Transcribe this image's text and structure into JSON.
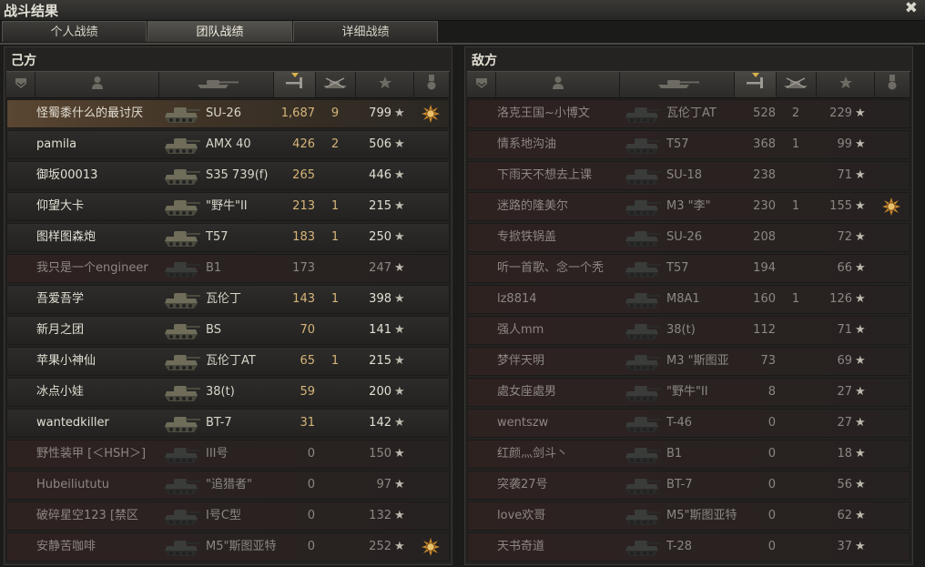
{
  "window": {
    "title": "战斗结果"
  },
  "tabs": [
    {
      "label": "个人战绩",
      "active": false
    },
    {
      "label": "团队战绩",
      "active": true
    },
    {
      "label": "详细战绩",
      "active": false
    }
  ],
  "left": {
    "title": "己方",
    "rows": [
      {
        "name": "怪蜀黍什么的最讨厌",
        "vehicle": "SU-26",
        "damage": "1,687",
        "kills": "9",
        "xp": "799",
        "mine": true,
        "alive": true,
        "medal": true
      },
      {
        "name": "pamila",
        "vehicle": "AMX 40",
        "damage": "426",
        "kills": "2",
        "xp": "506",
        "alive": true
      },
      {
        "name": "御坂00013",
        "vehicle": "S35 739(f)",
        "damage": "265",
        "kills": "",
        "xp": "446",
        "alive": true
      },
      {
        "name": "仰望大卡",
        "vehicle": "\"野牛\"II",
        "damage": "213",
        "kills": "1",
        "xp": "215",
        "alive": true
      },
      {
        "name": "图样图森炮",
        "vehicle": "T57",
        "damage": "183",
        "kills": "1",
        "xp": "250",
        "alive": true
      },
      {
        "name": "我只是一个engineer",
        "vehicle": "B1",
        "damage": "173",
        "kills": "",
        "xp": "247",
        "alive": false
      },
      {
        "name": "吾爱吾学",
        "vehicle": "瓦伦丁",
        "damage": "143",
        "kills": "1",
        "xp": "398",
        "alive": true
      },
      {
        "name": "新月之团",
        "vehicle": "BS",
        "damage": "70",
        "kills": "",
        "xp": "141",
        "alive": true
      },
      {
        "name": "苹果小神仙",
        "vehicle": "瓦伦丁AT",
        "damage": "65",
        "kills": "1",
        "xp": "215",
        "alive": true
      },
      {
        "name": "冰点小娃",
        "vehicle": "38(t)",
        "damage": "59",
        "kills": "",
        "xp": "200",
        "alive": true
      },
      {
        "name": "wantedkiller",
        "vehicle": "BT-7",
        "damage": "31",
        "kills": "",
        "xp": "142",
        "alive": true
      },
      {
        "name": "野性装甲 [＜HSH＞]",
        "vehicle": "III号",
        "damage": "0",
        "kills": "",
        "xp": "150",
        "alive": false
      },
      {
        "name": "Hubeiliututu",
        "vehicle": "\"追猎者\"",
        "damage": "0",
        "kills": "",
        "xp": "97",
        "alive": false
      },
      {
        "name": "破碎星空123 [禁区",
        "vehicle": "I号C型",
        "damage": "0",
        "kills": "",
        "xp": "132",
        "alive": false
      },
      {
        "name": "安静苦咖啡",
        "vehicle": "M5\"斯图亚特",
        "damage": "0",
        "kills": "",
        "xp": "252",
        "alive": false,
        "medal": true
      }
    ]
  },
  "right": {
    "title": "敌方",
    "rows": [
      {
        "name": "洛克王国~小博文",
        "vehicle": "瓦伦丁AT",
        "damage": "528",
        "kills": "2",
        "xp": "229",
        "alive": false
      },
      {
        "name": "情系地沟油",
        "vehicle": "T57",
        "damage": "368",
        "kills": "1",
        "xp": "99",
        "alive": false
      },
      {
        "name": "下雨天不想去上课",
        "vehicle": "SU-18",
        "damage": "238",
        "kills": "",
        "xp": "71",
        "alive": false
      },
      {
        "name": "迷路的隆美尔",
        "vehicle": "M3 \"李\"",
        "damage": "230",
        "kills": "1",
        "xp": "155",
        "alive": false,
        "medal": true
      },
      {
        "name": "专掀铁锅盖",
        "vehicle": "SU-26",
        "damage": "208",
        "kills": "",
        "xp": "72",
        "alive": false
      },
      {
        "name": "听一首歌、念一个秃",
        "vehicle": "T57",
        "damage": "194",
        "kills": "",
        "xp": "66",
        "alive": false
      },
      {
        "name": "lz8814",
        "vehicle": "M8A1",
        "damage": "160",
        "kills": "1",
        "xp": "126",
        "alive": false
      },
      {
        "name": "强人mm",
        "vehicle": "38(t)",
        "damage": "112",
        "kills": "",
        "xp": "71",
        "alive": false
      },
      {
        "name": "梦伴天明",
        "vehicle": "M3 \"斯图亚",
        "damage": "73",
        "kills": "",
        "xp": "69",
        "alive": false
      },
      {
        "name": "處女座處男",
        "vehicle": "\"野牛\"II",
        "damage": "8",
        "kills": "",
        "xp": "27",
        "alive": false
      },
      {
        "name": "wentszw",
        "vehicle": "T-46",
        "damage": "0",
        "kills": "",
        "xp": "27",
        "alive": false
      },
      {
        "name": "红颜灬剑斗丶",
        "vehicle": "B1",
        "damage": "0",
        "kills": "",
        "xp": "18",
        "alive": false
      },
      {
        "name": "突袭27号",
        "vehicle": "BT-7",
        "damage": "0",
        "kills": "",
        "xp": "56",
        "alive": false
      },
      {
        "name": "love欢哥",
        "vehicle": "M5\"斯图亚特",
        "damage": "0",
        "kills": "",
        "xp": "62",
        "alive": false
      },
      {
        "name": "天书奇道",
        "vehicle": "T-28",
        "damage": "0",
        "kills": "",
        "xp": "37",
        "alive": false
      }
    ]
  },
  "columns": [
    "squad-icon",
    "player-icon",
    "vehicle-icon",
    "damage-icon",
    "kills-icon",
    "star-icon",
    "medal-icon"
  ],
  "star_glyph": "★",
  "colors": {
    "damage": "#d6b47a",
    "sort_arrow": "#d8b24a",
    "mine_row": "#5a4632"
  }
}
